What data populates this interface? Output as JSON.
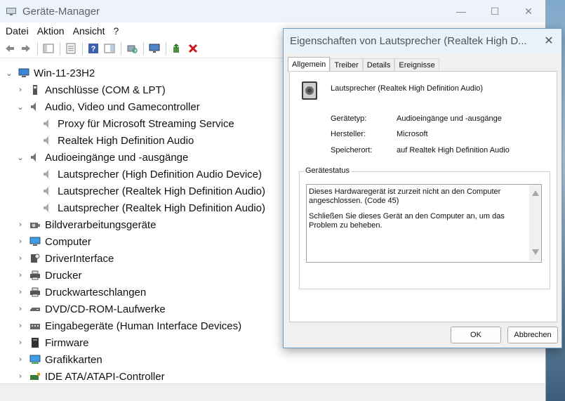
{
  "window": {
    "title": "Geräte-Manager",
    "controls": {
      "minimize": "—",
      "maximize": "☐",
      "close": "✕"
    }
  },
  "menu": [
    "Datei",
    "Aktion",
    "Ansicht",
    "?"
  ],
  "tree": {
    "root": "Win-11-23H2",
    "items": [
      {
        "label": "Anschlüsse (COM & LPT)",
        "expanded": false,
        "icon": "port-icon"
      },
      {
        "label": "Audio, Video und Gamecontroller",
        "expanded": true,
        "icon": "speaker-icon",
        "children": [
          "Proxy für Microsoft Streaming Service",
          "Realtek High Definition Audio"
        ]
      },
      {
        "label": "Audioeingänge und -ausgänge",
        "expanded": true,
        "icon": "speaker-icon",
        "children": [
          "Lautsprecher (High Definition Audio Device)",
          "Lautsprecher (Realtek High Definition Audio)",
          "Lautsprecher (Realtek High Definition Audio)"
        ]
      },
      {
        "label": "Bildverarbeitungsgeräte",
        "expanded": false,
        "icon": "camera-icon"
      },
      {
        "label": "Computer",
        "expanded": false,
        "icon": "monitor-icon"
      },
      {
        "label": "DriverInterface",
        "expanded": false,
        "icon": "driver-icon"
      },
      {
        "label": "Drucker",
        "expanded": false,
        "icon": "printer-icon"
      },
      {
        "label": "Druckwarteschlangen",
        "expanded": false,
        "icon": "printer-icon"
      },
      {
        "label": "DVD/CD-ROM-Laufwerke",
        "expanded": false,
        "icon": "drive-icon"
      },
      {
        "label": "Eingabegeräte (Human Interface Devices)",
        "expanded": false,
        "icon": "hid-icon"
      },
      {
        "label": "Firmware",
        "expanded": false,
        "icon": "chip-icon"
      },
      {
        "label": "Grafikkarten",
        "expanded": false,
        "icon": "display-adapter-icon"
      },
      {
        "label": "IDE ATA/ATAPI-Controller",
        "expanded": false,
        "icon": "controller-icon"
      }
    ]
  },
  "dialog": {
    "title": "Eigenschaften von Lautsprecher (Realtek High D...",
    "close": "✕",
    "tabs": [
      "Allgemein",
      "Treiber",
      "Details",
      "Ereignisse"
    ],
    "active_tab": "Allgemein",
    "device_name": "Lautsprecher (Realtek High Definition Audio)",
    "props": [
      {
        "label": "Gerätetyp:",
        "value": "Audioeingänge und -ausgänge"
      },
      {
        "label": "Hersteller:",
        "value": "Microsoft"
      },
      {
        "label": "Speicherort:",
        "value": "auf Realtek High Definition Audio"
      }
    ],
    "status_group": "Gerätestatus",
    "status_line1": "Dieses Hardwaregerät ist zurzeit nicht an den Computer angeschlossen. (Code 45)",
    "status_line2": "Schließen Sie dieses Gerät an den Computer an, um das Problem zu beheben.",
    "ok": "OK",
    "cancel": "Abbrechen"
  }
}
